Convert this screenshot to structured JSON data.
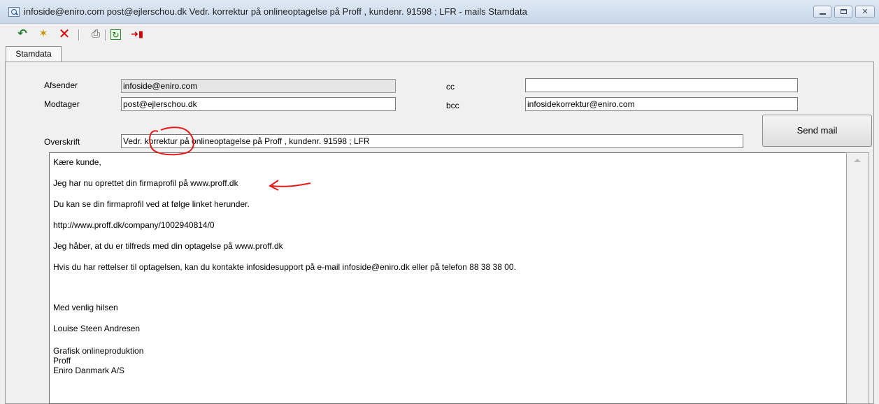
{
  "window": {
    "title": "infoside@eniro.com post@ejlerschou.dk Vedr. korrektur på onlineoptagelse på Proff , kundenr. 91598 ; LFR - mails Stamdata"
  },
  "toolbar": {
    "icons": [
      "return-icon",
      "new-icon",
      "delete-icon",
      "print-icon",
      "refresh-icon",
      "exit-icon"
    ]
  },
  "tabs": [
    {
      "label": "Stamdata",
      "active": true
    }
  ],
  "form": {
    "afsender_label": "Afsender",
    "afsender_value": "infoside@eniro.com",
    "modtager_label": "Modtager",
    "modtager_value": "post@ejlerschou.dk",
    "cc_label": "cc",
    "cc_value": "",
    "bcc_label": "bcc",
    "bcc_value": "infosidekorrektur@eniro.com",
    "overskrift_label": "Overskrift",
    "overskrift_value": "Vedr. korrektur på onlineoptagelse på Proff , kundenr. 91598 ; LFR",
    "send_button": "Send mail"
  },
  "body_lines": [
    "Kære kunde,",
    "Jeg har nu oprettet din firmaprofil på www.proff.dk",
    "Du kan se din firmaprofil ved at følge linket herunder.",
    "http://www.proff.dk/company/1002940814/0",
    "Jeg håber, at du er tilfreds med din optagelse på www.proff.dk",
    "Hvis du har rettelser til optagelsen, kan du kontakte infosidesupport på e-mail infoside@eniro.dk eller på telefon 88 38 38 00.",
    "Med venlig hilsen",
    "Louise Steen Andresen",
    "Grafisk onlineproduktion",
    "Proff",
    "Eniro Danmark A/S"
  ],
  "annotation_color": "#e31b1b"
}
